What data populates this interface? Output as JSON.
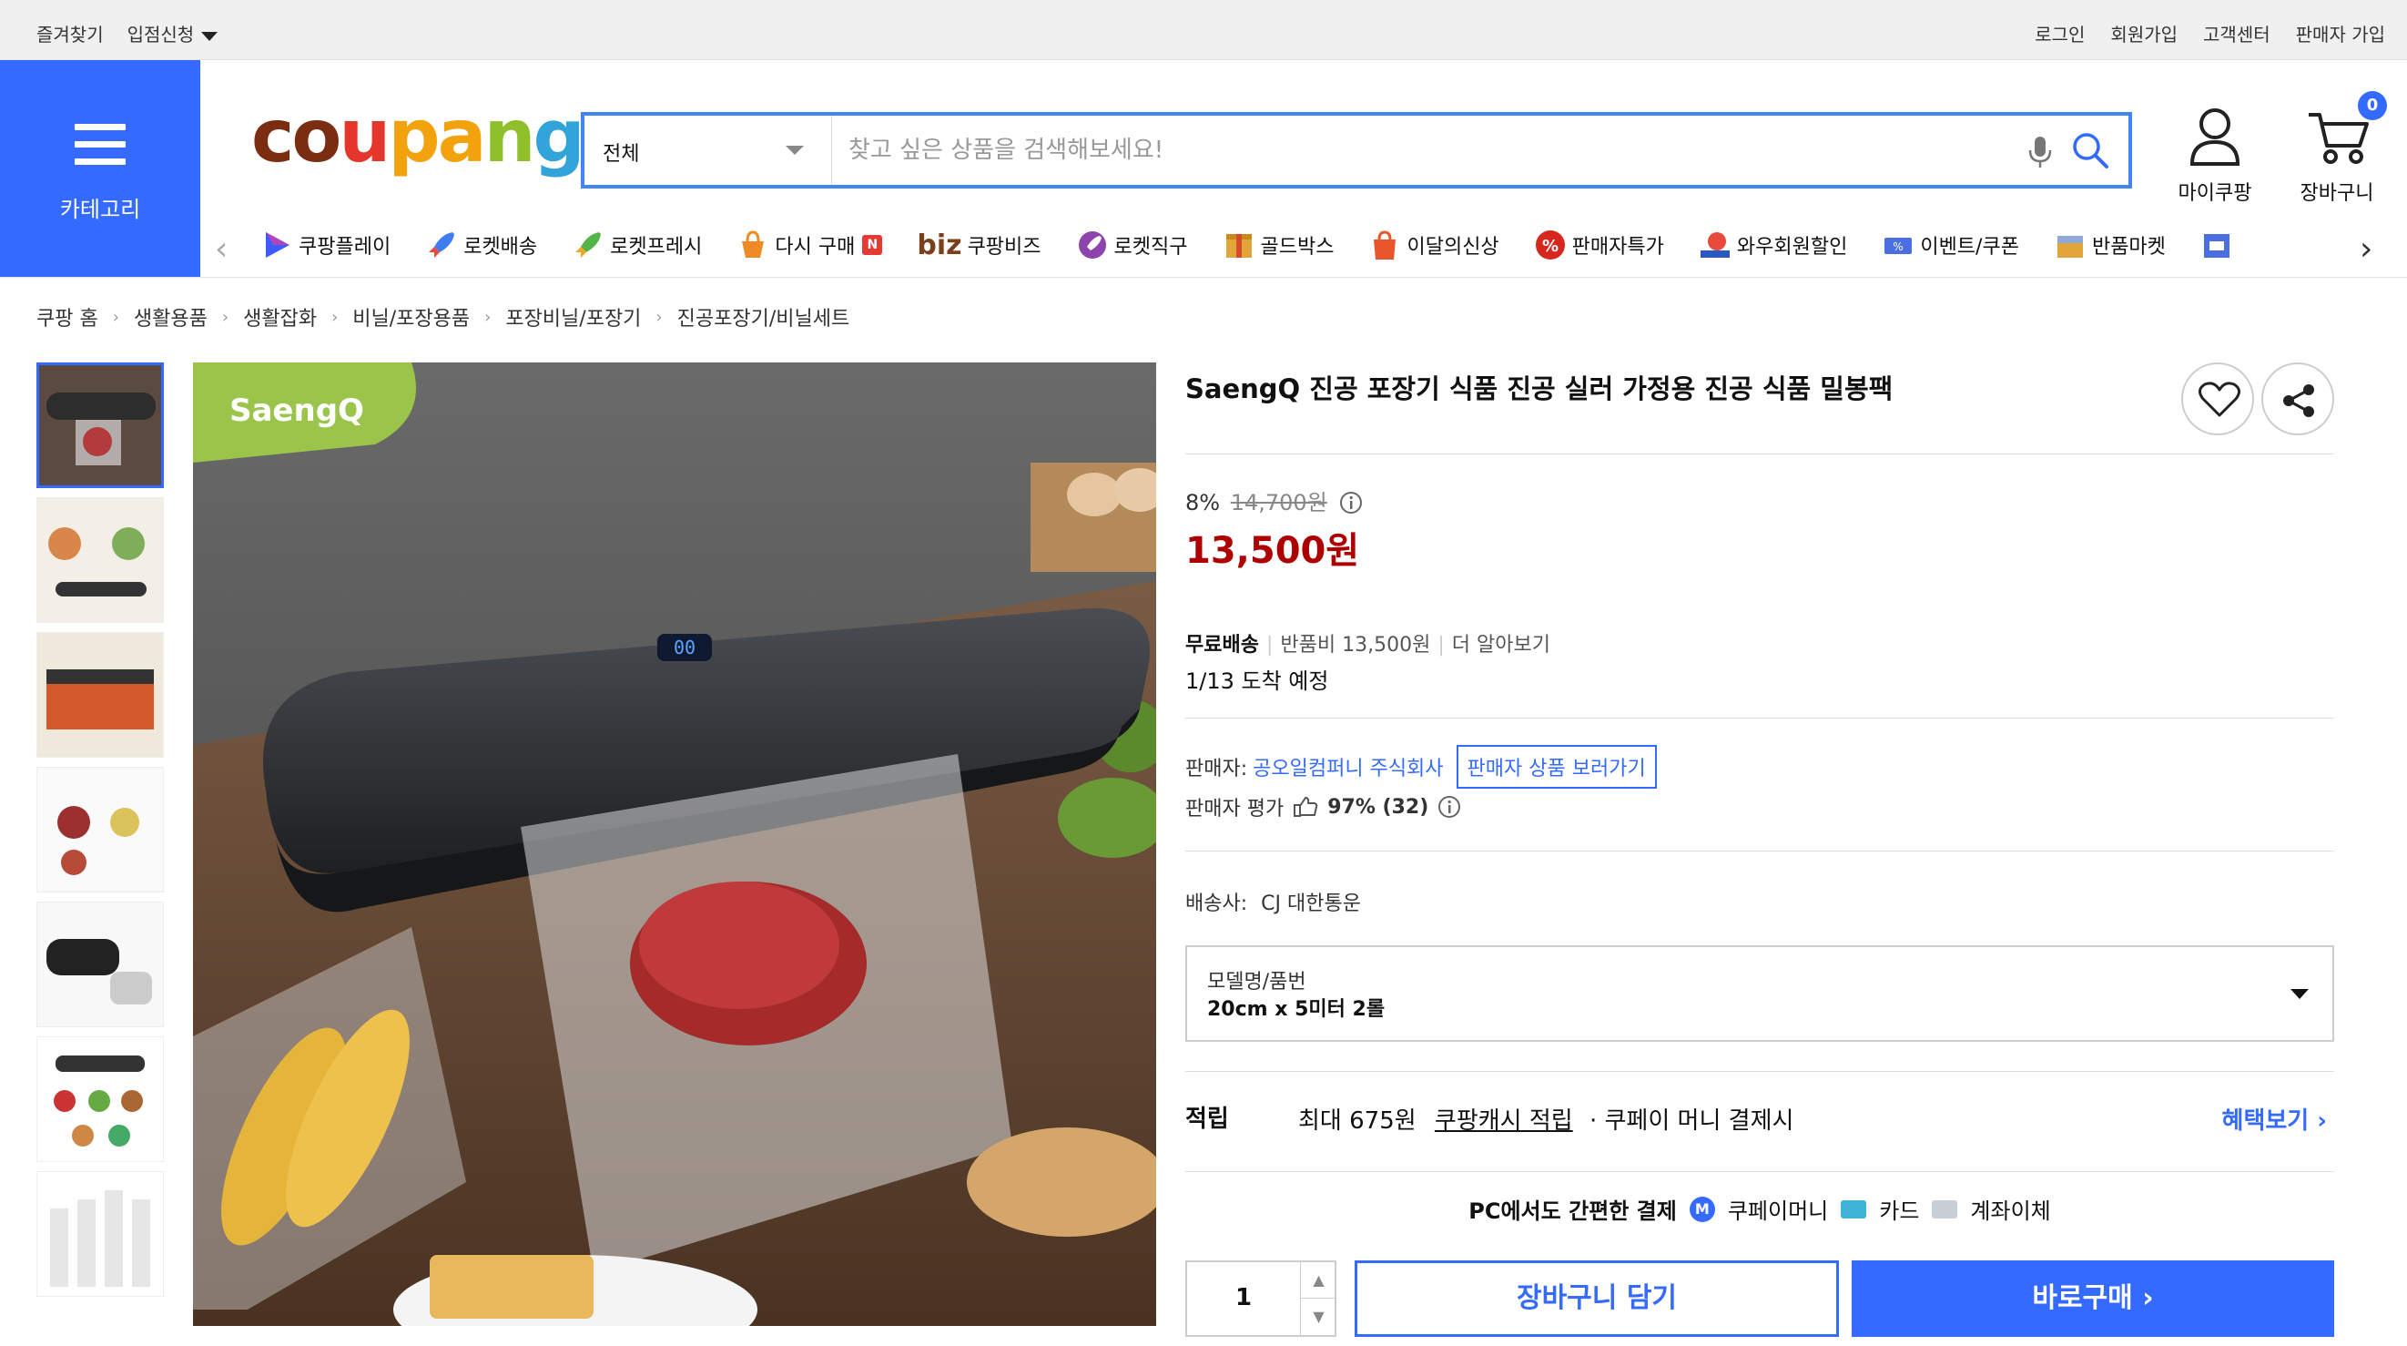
{
  "topbar": {
    "favorites": "즐겨찾기",
    "apply": "입점신청",
    "login": "로그인",
    "signup": "회원가입",
    "support": "고객센터",
    "seller_signup": "판매자 가입"
  },
  "category_label": "카테고리",
  "search": {
    "scope": "전체",
    "placeholder": "찾고 싶은 상품을 검색해보세요!"
  },
  "header": {
    "mypage": "마이쿠팡",
    "cart": "장바구니",
    "cart_count": "0"
  },
  "services": [
    {
      "label": "쿠팡플레이",
      "icon": "play-icon"
    },
    {
      "label": "로켓배송",
      "icon": "rocket-icon"
    },
    {
      "label": "로켓프레시",
      "icon": "rocket-fresh-icon"
    },
    {
      "label": "다시 구매",
      "icon": "rebuy-icon",
      "badge": "N"
    },
    {
      "label": "쿠팡비즈",
      "prefix": "biz"
    },
    {
      "label": "로켓직구",
      "icon": "rocket-global-icon"
    },
    {
      "label": "골드박스",
      "icon": "goldbox-icon"
    },
    {
      "label": "이달의신상",
      "icon": "new-arrivals-icon"
    },
    {
      "label": "판매자특가",
      "icon": "seller-deal-icon"
    },
    {
      "label": "와우회원할인",
      "icon": "wow-icon"
    },
    {
      "label": "이벤트/쿠폰",
      "icon": "coupon-icon"
    },
    {
      "label": "반품마켓",
      "icon": "return-market-icon"
    }
  ],
  "breadcrumb": [
    "쿠팡 홈",
    "생활용품",
    "생활잡화",
    "비닐/포장용품",
    "포장비닐/포장기",
    "진공포장기/비닐세트"
  ],
  "product": {
    "title": "SaengQ 진공 포장기 식품 진공 실러 가정용 진공 식품 밀봉팩",
    "brand_mark": "SaengQ",
    "discount_rate": "8%",
    "original_price": "14,700원",
    "price": "13,500원",
    "shipping_free": "무료배송",
    "return_fee": "반품비 13,500원",
    "learn_more": "더 알아보기",
    "arrival": "1/13 도착 예정",
    "seller_label": "판매자:",
    "seller_name": "공오일컴퍼니 주식회사",
    "seller_products": "판매자 상품 보러가기",
    "rating_label": "판매자 평가",
    "rating_value": "97% (32)",
    "carrier_label": "배송사:",
    "carrier_name": "CJ 대한통운",
    "option_label": "모델명/품번",
    "option_value": "20cm x 5미터 2롤",
    "reward_title": "적립",
    "reward_prefix": "최대 675원",
    "reward_link": "쿠팡캐시 적립",
    "reward_suffix": "· 쿠페이 머니 결제시",
    "reward_more": "혜택보기",
    "pay_title": "PC에서도 간편한 결제",
    "pay_badge": "M",
    "pay_money": "쿠페이머니",
    "pay_card": "카드",
    "pay_bank": "계좌이체",
    "quantity": "1",
    "add_to_cart": "장바구니 담기",
    "buy_now": "바로구매"
  },
  "colors": {
    "accent": "#346aff",
    "price_red": "#ae0000"
  }
}
